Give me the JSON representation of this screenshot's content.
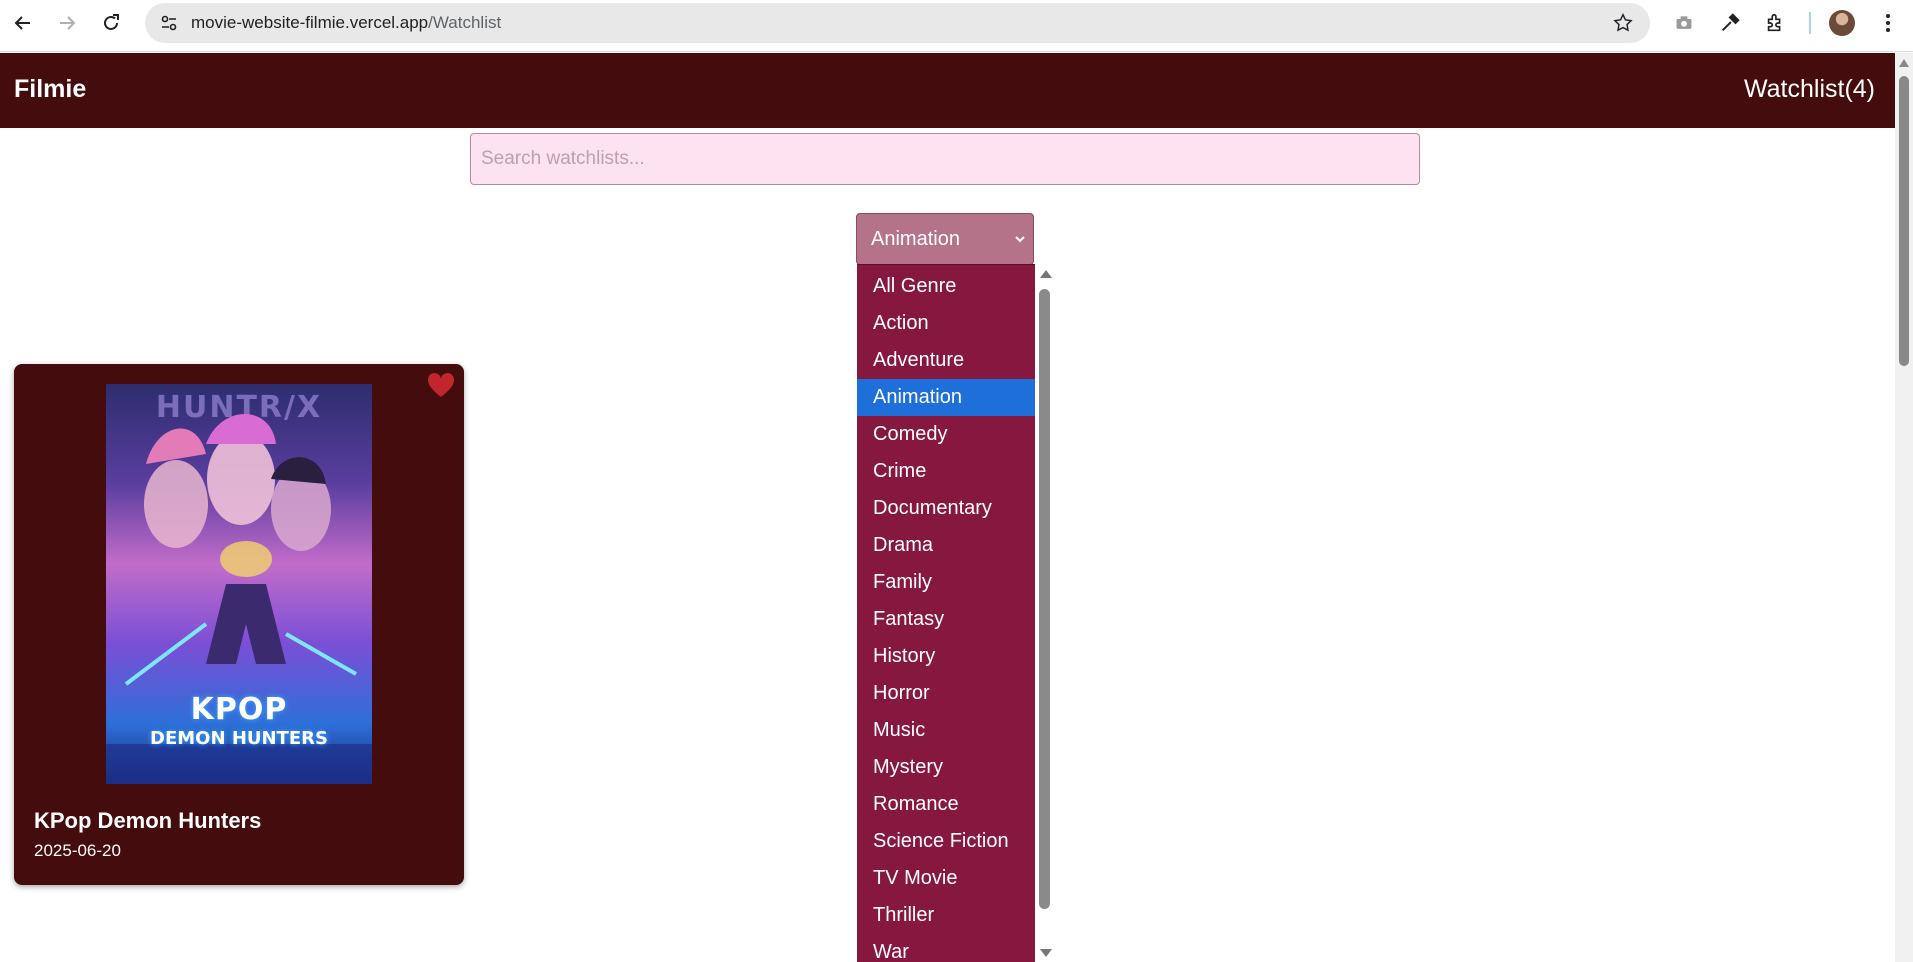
{
  "browser": {
    "url_host": "movie-website-filmie.vercel.app",
    "url_path": "/Watchlist"
  },
  "header": {
    "brand": "Filmie",
    "watchlist_label": "Watchlist(4)"
  },
  "search": {
    "placeholder": "Search watchlists..."
  },
  "genre_select": {
    "selected": "Animation",
    "options": [
      "All Genre",
      "Action",
      "Adventure",
      "Animation",
      "Comedy",
      "Crime",
      "Documentary",
      "Drama",
      "Family",
      "Fantasy",
      "History",
      "Horror",
      "Music",
      "Mystery",
      "Romance",
      "Science Fiction",
      "TV Movie",
      "Thriller",
      "War"
    ],
    "highlighted_index": 3
  },
  "movies": [
    {
      "title": "KPop Demon Hunters",
      "release_date": "2025-06-20",
      "poster_text_top": "HUNTR/X",
      "poster_text_main": "KPOP",
      "poster_text_sub": "DEMON HUNTERS",
      "favorited": true
    }
  ],
  "colors": {
    "header_bg": "#440c0c",
    "search_bg": "#fde2f1",
    "select_bg": "#b57389",
    "dropdown_bg": "#86173f",
    "dropdown_highlight": "#1e6fd9",
    "card_bg": "#440c0c",
    "heart": "#c0262b"
  }
}
